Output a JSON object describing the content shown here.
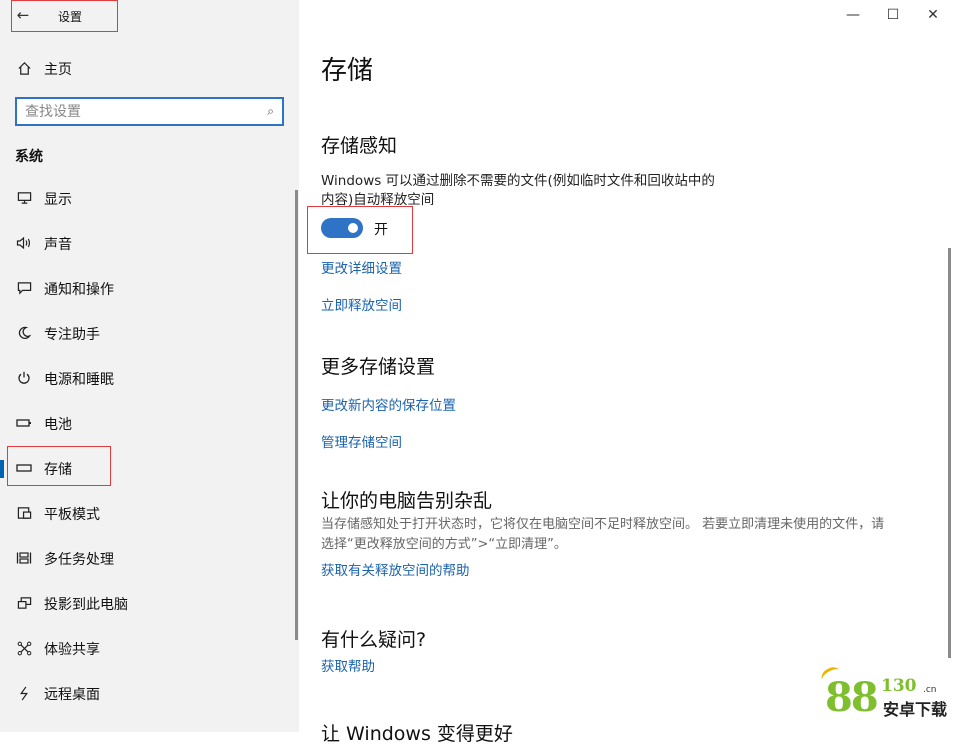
{
  "header": {
    "back_symbol": "←",
    "title": "设置"
  },
  "sidebar": {
    "home": {
      "icon": "home-icon",
      "label": "主页"
    },
    "search": {
      "placeholder": "查找设置",
      "icon": "search-icon"
    },
    "section_title": "系统",
    "items": [
      {
        "id": "display",
        "icon": "monitor-icon",
        "label": "显示"
      },
      {
        "id": "sound",
        "icon": "speaker-icon",
        "label": "声音"
      },
      {
        "id": "notifications",
        "icon": "message-icon",
        "label": "通知和操作"
      },
      {
        "id": "focus",
        "icon": "moon-icon",
        "label": "专注助手"
      },
      {
        "id": "power",
        "icon": "power-icon",
        "label": "电源和睡眠"
      },
      {
        "id": "battery",
        "icon": "battery-icon",
        "label": "电池"
      },
      {
        "id": "storage",
        "icon": "storage-icon",
        "label": "存储",
        "selected": true
      },
      {
        "id": "tablet",
        "icon": "tablet-icon",
        "label": "平板模式"
      },
      {
        "id": "multitasking",
        "icon": "multitask-icon",
        "label": "多任务处理"
      },
      {
        "id": "projecting",
        "icon": "project-icon",
        "label": "投影到此电脑"
      },
      {
        "id": "shared",
        "icon": "share-icon",
        "label": "体验共享"
      },
      {
        "id": "remote",
        "icon": "remote-desktop-icon",
        "label": "远程桌面"
      }
    ]
  },
  "window_controls": {
    "minimize": "—",
    "maximize": "☐",
    "close": "✕"
  },
  "main": {
    "title": "存储",
    "storage_sense": {
      "heading": "存储感知",
      "desc_line1": "Windows 可以通过删除不需要的文件(例如临时文件和回收站中的",
      "desc_line2": "内容)自动释放空间",
      "toggle_label": "开",
      "toggle_on": true,
      "link_configure": "更改详细设置",
      "link_free_now": "立即释放空间"
    },
    "more_storage": {
      "heading": "更多存储设置",
      "link_save_location": "更改新内容的保存位置",
      "link_manage_spaces": "管理存储空间"
    },
    "declutter": {
      "heading": "让你的电脑告别杂乱",
      "desc_line1": "当存储感知处于打开状态时，它将仅在电脑空间不足时释放空间。 若要立即清理未使用的文件，请",
      "desc_line2": "选择“更改释放空间的方式”>“立即清理”。",
      "link_help": "获取有关释放空间的帮助"
    },
    "questions": {
      "heading": "有什么疑问?",
      "link": "获取帮助"
    },
    "better": {
      "heading": "让 Windows 变得更好"
    }
  },
  "watermark": {
    "big": "88",
    "small": "130",
    "domain": ".cn",
    "text": "安卓下载"
  },
  "colors": {
    "accent": "#2f73c6",
    "link": "#1b63ad",
    "annotation": "#e23b3b",
    "sidebar_bg": "#f2f2f2"
  }
}
